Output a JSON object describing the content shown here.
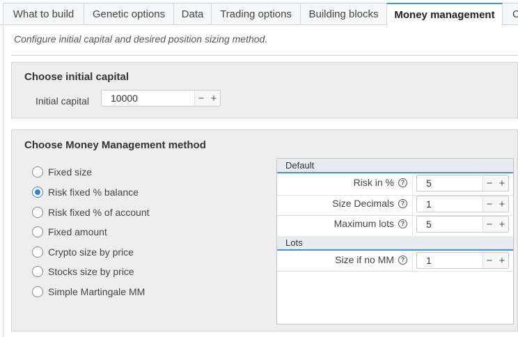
{
  "tabs": [
    {
      "label": "What to build"
    },
    {
      "label": "Genetic options"
    },
    {
      "label": "Data"
    },
    {
      "label": "Trading options"
    },
    {
      "label": "Building blocks"
    },
    {
      "label": "Money management",
      "active": true
    },
    {
      "label": "C"
    }
  ],
  "description": "Configure initial capital and desired position sizing method.",
  "capital": {
    "title": "Choose initial capital",
    "label": "Initial capital",
    "value": "10000"
  },
  "mm": {
    "title": "Choose Money Management method",
    "methods": [
      {
        "label": "Fixed size",
        "selected": false
      },
      {
        "label": "Risk fixed % balance",
        "selected": true
      },
      {
        "label": "Risk fixed % of account",
        "selected": false
      },
      {
        "label": "Fixed amount",
        "selected": false
      },
      {
        "label": "Crypto size by price",
        "selected": false
      },
      {
        "label": "Stocks size by price",
        "selected": false
      },
      {
        "label": "Simple Martingale MM",
        "selected": false
      }
    ],
    "settings": {
      "default_header": "Default",
      "risk_label": "Risk in %",
      "risk_value": "5",
      "decimals_label": "Size Decimals",
      "decimals_value": "1",
      "maxlots_label": "Maximum lots",
      "maxlots_value": "5",
      "lots_header": "Lots",
      "size_no_mm_label": "Size if no MM",
      "size_no_mm_value": "1"
    }
  },
  "icons": {
    "minus": "−",
    "plus": "+",
    "help": "?"
  },
  "colors": {
    "accent": "#4a90d9",
    "panel_bg": "#eeeeee"
  }
}
